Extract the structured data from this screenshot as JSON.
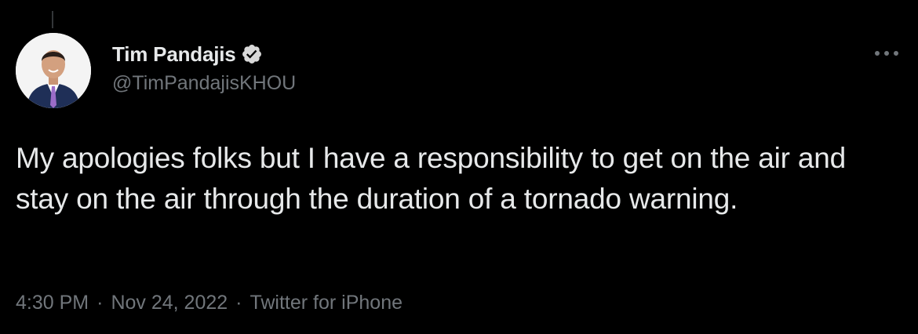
{
  "author": {
    "display_name": "Tim Pandajis",
    "handle": "@TimPandajisKHOU",
    "verified": true,
    "avatar_icon": "profile-photo"
  },
  "tweet": {
    "text": "My apologies folks but I have a responsibility to get on the air and stay on the air through the duration of a tornado warning."
  },
  "meta": {
    "time": "4:30 PM",
    "separator": "·",
    "date": "Nov 24, 2022",
    "source": "Twitter for iPhone"
  },
  "icons": {
    "verified": "verified-badge-icon",
    "more": "more-options-icon"
  },
  "colors": {
    "background": "#000000",
    "primary_text": "#e7e9ea",
    "secondary_text": "#71767b",
    "verified_badge": "#d9d9d9"
  }
}
